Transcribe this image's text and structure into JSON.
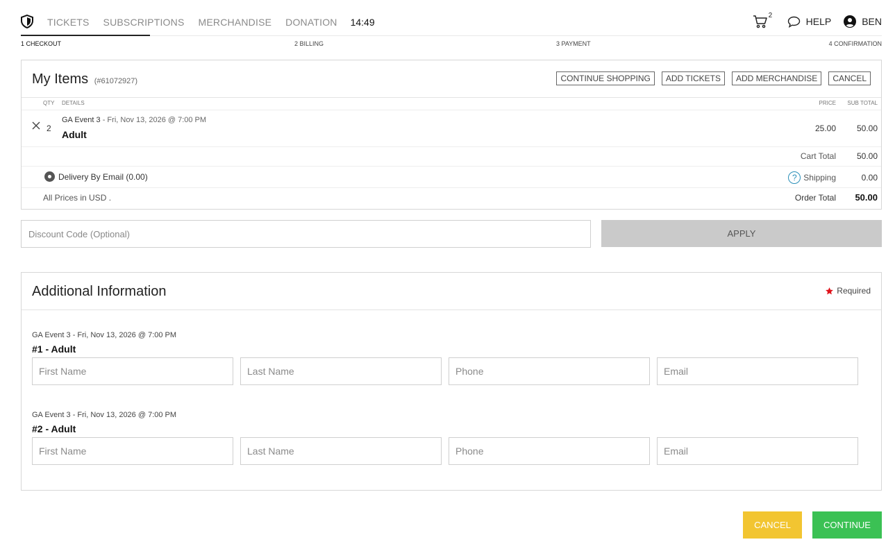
{
  "nav": {
    "logo_icon": "shield-logo-icon",
    "links": [
      "TICKETS",
      "SUBSCRIPTIONS",
      "MERCHANDISE",
      "DONATION"
    ],
    "clock": "14:49",
    "cart_icon": "cart-icon",
    "cart_count": "2",
    "help_icon": "chat-bubble-icon",
    "help_label": "HELP",
    "user_icon": "user-circle-icon",
    "user_label": "BEN"
  },
  "steps": [
    "1 CHECKOUT",
    "2 BILLING",
    "3 PAYMENT",
    "4 CONFIRMATION"
  ],
  "items": {
    "title": "My Items",
    "order_number": "(#61072927)",
    "buttons": [
      "CONTINUE SHOPPING",
      "ADD TICKETS",
      "ADD MERCHANDISE",
      "CANCEL"
    ],
    "columns": {
      "qty": "QTY",
      "details": "DETAILS",
      "price": "PRICE",
      "subtotal": "SUB TOTAL"
    },
    "line": {
      "qty": "2",
      "event": "GA Event 3",
      "datetime": " - Fri, Nov 13, 2026 @ 7:00 PM",
      "type": "Adult",
      "price": "25.00",
      "subtotal": "50.00"
    },
    "cart_total_label": "Cart Total",
    "cart_total": "50.00",
    "delivery": "Delivery By Email (0.00)",
    "shipping_label": "Shipping",
    "shipping": "0.00",
    "prices_note": "All Prices in USD .",
    "order_total_label": "Order Total",
    "order_total": "50.00"
  },
  "discount": {
    "placeholder": "Discount Code (Optional)",
    "apply_label": "APPLY"
  },
  "additional": {
    "title": "Additional Information",
    "required_label": "Required",
    "required_color": "#e0131b",
    "guests": [
      {
        "event": "GA Event 3 - Fri, Nov 13, 2026 @ 7:00 PM",
        "label": "#1 - Adult"
      },
      {
        "event": "GA Event 3 - Fri, Nov 13, 2026 @ 7:00 PM",
        "label": "#2 - Adult"
      }
    ],
    "placeholders": {
      "first": "First Name",
      "last": "Last Name",
      "phone": "Phone",
      "email": "Email"
    }
  },
  "footer": {
    "cancel_label": "CANCEL",
    "continue_label": "CONTINUE",
    "cancel_color": "#f2c531",
    "continue_color": "#3bc154"
  }
}
